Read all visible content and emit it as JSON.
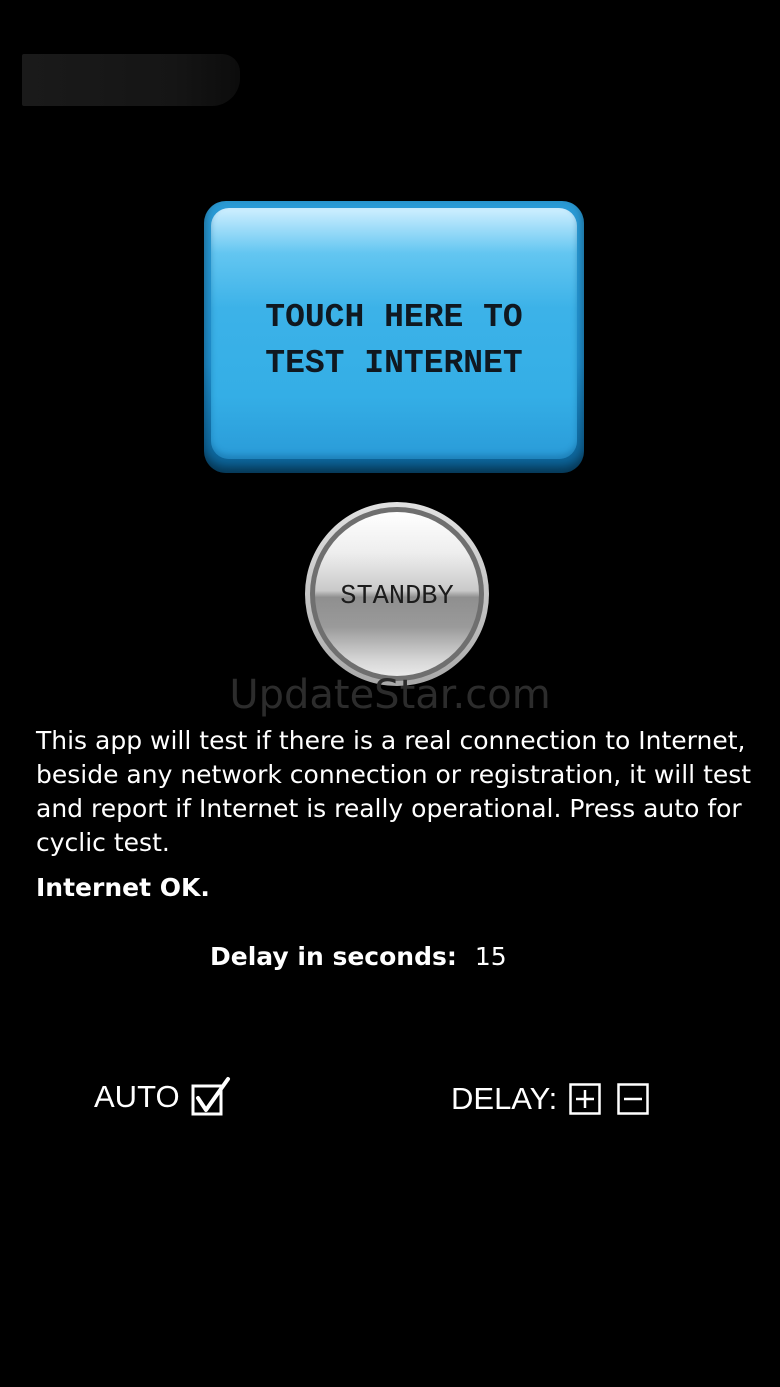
{
  "app": {
    "test_button_label": "TOUCH HERE TO\nTEST INTERNET",
    "standby_label": "STANDBY",
    "watermark": "UpdateStar.com",
    "description": "This app will test if there is a real connection to Internet, beside any network connection or registration, it will test and report if Internet is really operational. Press auto for cyclic test.",
    "status": "Internet OK.",
    "delay_label": "Delay in seconds:",
    "delay_value": "15"
  },
  "controls": {
    "auto_label": "AUTO",
    "auto_checked": true,
    "delay_label": "DELAY:",
    "plus_icon": "plus-box-icon",
    "minus_icon": "minus-box-icon"
  },
  "colors": {
    "background": "#000000",
    "button_blue": "#3cb2e8",
    "text": "#ffffff"
  }
}
